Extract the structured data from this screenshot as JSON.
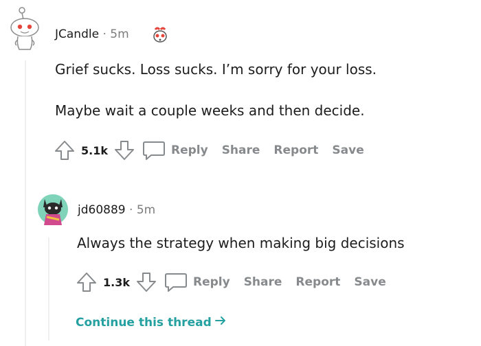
{
  "comment1": {
    "author": "JCandle",
    "separator": "·",
    "time": "5m",
    "lines": [
      "Grief sucks. Loss sucks. I’m sorry for your loss.",
      "Maybe wait a couple weeks and then decide."
    ],
    "votes": "5.1k",
    "reply_label": "Reply",
    "share_label": "Share",
    "report_label": "Report",
    "save_label": "Save"
  },
  "comment2": {
    "author": "jd60889",
    "separator": "·",
    "time": "5m",
    "lines": [
      "Always the strategy when making big decisions"
    ],
    "votes": "1.3k",
    "reply_label": "Reply",
    "share_label": "Share",
    "report_label": "Report",
    "save_label": "Save"
  },
  "continue_label": "Continue this thread",
  "colors": {
    "action_gray": "#878a8c",
    "thread_line": "#edeff1",
    "link_teal": "#24a0a0",
    "snoo_red": "#e4463c"
  }
}
